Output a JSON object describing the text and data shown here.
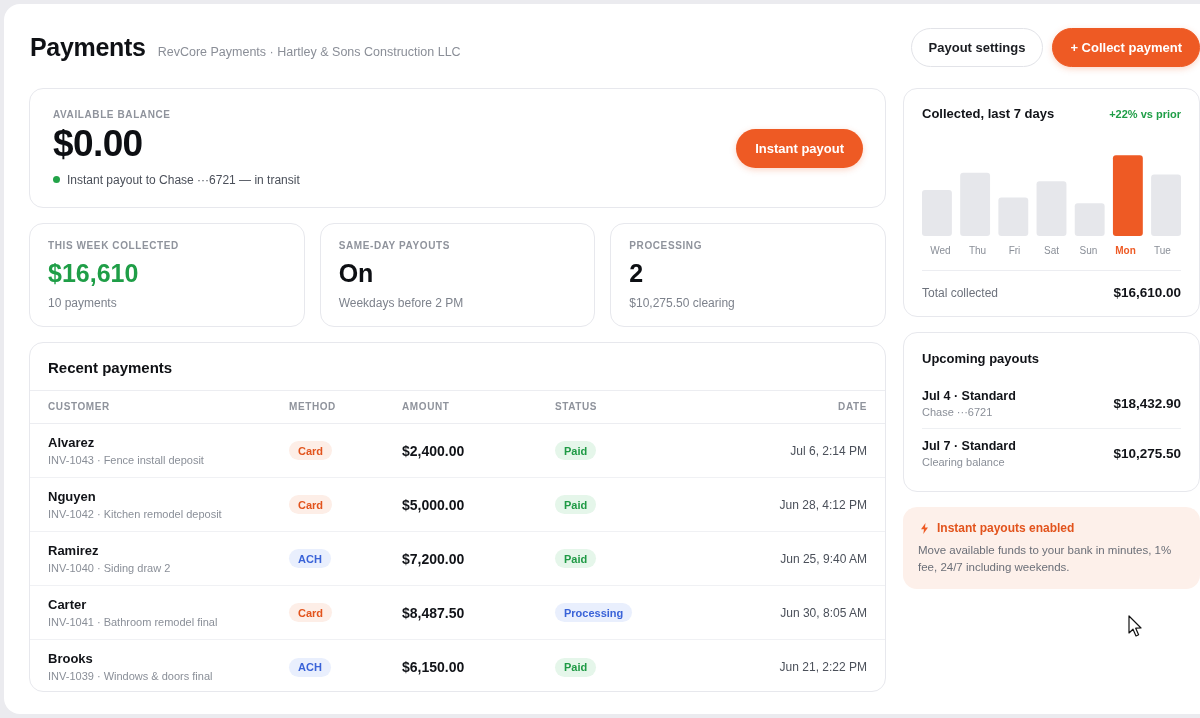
{
  "header": {
    "title": "Payments",
    "subtitle": "RevCore Payments · Hartley & Sons Construction LLC",
    "buttons": [
      {
        "label": "Payout settings",
        "kind": "secondary"
      },
      {
        "label": "+ Collect payment",
        "kind": "primary"
      }
    ]
  },
  "balance": {
    "label": "AVAILABLE BALANCE",
    "amount": "$0.00",
    "status": "Instant payout to Chase ···6721 — in transit",
    "button": "Instant payout"
  },
  "stats": [
    {
      "label": "THIS WEEK COLLECTED",
      "value": "$16,610",
      "note": "10 payments",
      "kind": "positive"
    },
    {
      "label": "SAME-DAY PAYOUTS",
      "value": "On",
      "note": "Weekdays before 2 PM",
      "kind": "plain"
    },
    {
      "label": "PROCESSING",
      "value": "2",
      "note": "$10,275.50 clearing",
      "kind": "plain"
    }
  ],
  "recent_payments": {
    "title": "Recent payments",
    "columns": [
      "CUSTOMER",
      "METHOD",
      "AMOUNT",
      "STATUS",
      "DATE"
    ],
    "rows": [
      {
        "customer": "Alvarez",
        "invoice": "INV-1043 · Fence install deposit",
        "method": {
          "label": "Card",
          "kind": "card"
        },
        "amount": "$2,400.00",
        "status": {
          "label": "Paid",
          "kind": "paid"
        },
        "date": "Jul 6, 2:14 PM"
      },
      {
        "customer": "Nguyen",
        "invoice": "INV-1042 · Kitchen remodel deposit",
        "method": {
          "label": "Card",
          "kind": "card"
        },
        "amount": "$5,000.00",
        "status": {
          "label": "Paid",
          "kind": "paid"
        },
        "date": "Jun 28, 4:12 PM"
      },
      {
        "customer": "Ramirez",
        "invoice": "INV-1040 · Siding draw 2",
        "method": {
          "label": "ACH",
          "kind": "ach"
        },
        "amount": "$7,200.00",
        "status": {
          "label": "Paid",
          "kind": "paid"
        },
        "date": "Jun 25, 9:40 AM"
      },
      {
        "customer": "Carter",
        "invoice": "INV-1041 · Bathroom remodel final",
        "method": {
          "label": "Card",
          "kind": "card"
        },
        "amount": "$8,487.50",
        "status": {
          "label": "Processing",
          "kind": "processing"
        },
        "date": "Jun 30, 8:05 AM"
      },
      {
        "customer": "Brooks",
        "invoice": "INV-1039 · Windows & doors final",
        "method": {
          "label": "ACH",
          "kind": "ach"
        },
        "amount": "$6,150.00",
        "status": {
          "label": "Paid",
          "kind": "paid"
        },
        "date": "Jun 21, 2:22 PM"
      }
    ]
  },
  "collected": {
    "title": "Collected, last 7 days",
    "change": "+22% vs prior",
    "days": [
      {
        "label": "Wed",
        "selected": false
      },
      {
        "label": "Thu",
        "selected": false
      },
      {
        "label": "Fri",
        "selected": false
      },
      {
        "label": "Sat",
        "selected": false
      },
      {
        "label": "Sun",
        "selected": false
      },
      {
        "label": "Mon",
        "selected": true
      },
      {
        "label": "Tue",
        "selected": false
      }
    ],
    "total_label": "Total collected",
    "total": "$16,610.00"
  },
  "upcoming_payouts": {
    "title": "Upcoming payouts",
    "items": [
      {
        "title": "Jul 4 · Standard",
        "subtitle": "Chase ···6721",
        "amount": "$18,432.90"
      },
      {
        "title": "Jul 7 · Standard",
        "subtitle": "Clearing balance",
        "amount": "$10,275.50"
      }
    ]
  },
  "notice": {
    "title": "Instant payouts enabled",
    "body": "Move available funds to your bank in minutes, 1% fee, 24/7 including weekends."
  }
}
